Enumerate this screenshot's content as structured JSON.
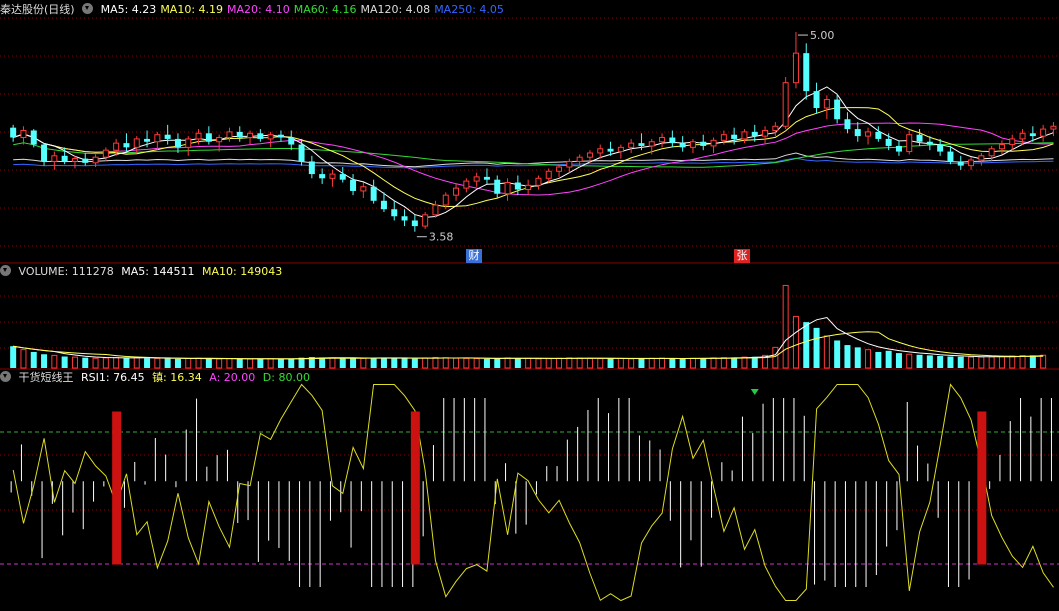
{
  "panels": {
    "price": {
      "title": "秦达股份(日线)",
      "ma": [
        {
          "label": "MA5: 4.23",
          "color": "#ffffff"
        },
        {
          "label": "MA10: 4.19",
          "color": "#ffff55"
        },
        {
          "label": "MA20: 4.10",
          "color": "#ff44ff"
        },
        {
          "label": "MA60: 4.16",
          "color": "#33dd33"
        },
        {
          "label": "MA120: 4.08",
          "color": "#dddddd"
        },
        {
          "label": "MA250: 4.05",
          "color": "#3366ff"
        }
      ],
      "high_label": "5.00",
      "low_label": "3.58",
      "events": [
        {
          "text": "财",
          "color": "#3a6fd8"
        },
        {
          "text": "张",
          "color": "#dd2222"
        }
      ]
    },
    "volume": {
      "title": "VOLUME: 111278",
      "ma5": "MA5: 144511",
      "ma10": "MA10: 149043"
    },
    "indicator": {
      "title": "干货短线王",
      "rsi": "RSI1: 76.45",
      "tan": "镇: 16.34",
      "a": "A: 20.00",
      "d": "D: 80.00"
    }
  },
  "colors": {
    "up": "#ff3a3a",
    "down": "#54ffff",
    "ma5": "#ffffff",
    "ma10": "#ffff55",
    "ma20": "#ff44ff",
    "ma60": "#33dd33",
    "ma120": "#dddddd",
    "ma250": "#3366ff",
    "vol_ma5": "#ffffff",
    "vol_ma10": "#ffff55",
    "rsi": "#ffffff",
    "line2": "#dddd22",
    "mark": "#cc1111",
    "grid": "#8b0000",
    "levelA": "#33aa33",
    "levelD": "#cc33cc"
  },
  "chart_data": {
    "type": "candlestick",
    "symbol": "秦达股份",
    "period": "日线",
    "price_high": 5.0,
    "price_low": 3.58,
    "ohlc": [
      [
        4.32,
        4.34,
        4.22,
        4.25
      ],
      [
        4.25,
        4.33,
        4.2,
        4.3
      ],
      [
        4.3,
        4.31,
        4.18,
        4.2
      ],
      [
        4.2,
        4.21,
        4.05,
        4.08
      ],
      [
        4.08,
        4.15,
        4.02,
        4.12
      ],
      [
        4.12,
        4.18,
        4.06,
        4.08
      ],
      [
        4.08,
        4.12,
        4.03,
        4.1
      ],
      [
        4.1,
        4.14,
        4.05,
        4.07
      ],
      [
        4.07,
        4.13,
        4.04,
        4.11
      ],
      [
        4.11,
        4.18,
        4.08,
        4.16
      ],
      [
        4.16,
        4.24,
        4.12,
        4.21
      ],
      [
        4.21,
        4.28,
        4.15,
        4.18
      ],
      [
        4.18,
        4.26,
        4.14,
        4.24
      ],
      [
        4.24,
        4.3,
        4.18,
        4.22
      ],
      [
        4.22,
        4.29,
        4.16,
        4.27
      ],
      [
        4.27,
        4.34,
        4.2,
        4.24
      ],
      [
        4.24,
        4.28,
        4.14,
        4.18
      ],
      [
        4.18,
        4.26,
        4.12,
        4.24
      ],
      [
        4.24,
        4.31,
        4.2,
        4.28
      ],
      [
        4.28,
        4.33,
        4.2,
        4.22
      ],
      [
        4.22,
        4.27,
        4.15,
        4.25
      ],
      [
        4.25,
        4.32,
        4.22,
        4.29
      ],
      [
        4.29,
        4.33,
        4.22,
        4.25
      ],
      [
        4.25,
        4.3,
        4.2,
        4.28
      ],
      [
        4.28,
        4.31,
        4.22,
        4.24
      ],
      [
        4.24,
        4.29,
        4.18,
        4.27
      ],
      [
        4.27,
        4.3,
        4.22,
        4.25
      ],
      [
        4.25,
        4.3,
        4.16,
        4.2
      ],
      [
        4.2,
        4.24,
        4.05,
        4.08
      ],
      [
        4.08,
        4.12,
        3.96,
        3.99
      ],
      [
        3.99,
        4.03,
        3.92,
        3.96
      ],
      [
        3.96,
        4.02,
        3.9,
        3.99
      ],
      [
        3.99,
        4.04,
        3.93,
        3.95
      ],
      [
        3.95,
        3.99,
        3.84,
        3.87
      ],
      [
        3.87,
        3.93,
        3.82,
        3.9
      ],
      [
        3.9,
        3.95,
        3.78,
        3.8
      ],
      [
        3.8,
        3.86,
        3.72,
        3.74
      ],
      [
        3.74,
        3.8,
        3.66,
        3.69
      ],
      [
        3.69,
        3.74,
        3.62,
        3.66
      ],
      [
        3.66,
        3.7,
        3.58,
        3.62
      ],
      [
        3.62,
        3.72,
        3.6,
        3.7
      ],
      [
        3.7,
        3.8,
        3.68,
        3.77
      ],
      [
        3.77,
        3.86,
        3.74,
        3.84
      ],
      [
        3.84,
        3.92,
        3.8,
        3.89
      ],
      [
        3.89,
        3.96,
        3.86,
        3.94
      ],
      [
        3.94,
        4.0,
        3.9,
        3.97
      ],
      [
        3.97,
        4.03,
        3.92,
        3.95
      ],
      [
        3.95,
        3.98,
        3.82,
        3.85
      ],
      [
        3.85,
        3.96,
        3.8,
        3.93
      ],
      [
        3.93,
        3.98,
        3.84,
        3.88
      ],
      [
        3.88,
        3.95,
        3.84,
        3.91
      ],
      [
        3.91,
        3.98,
        3.88,
        3.96
      ],
      [
        3.96,
        4.03,
        3.93,
        4.01
      ],
      [
        4.01,
        4.06,
        3.97,
        4.04
      ],
      [
        4.04,
        4.1,
        4.0,
        4.08
      ],
      [
        4.08,
        4.13,
        4.04,
        4.11
      ],
      [
        4.11,
        4.16,
        4.07,
        4.14
      ],
      [
        4.14,
        4.2,
        4.1,
        4.17
      ],
      [
        4.17,
        4.22,
        4.12,
        4.15
      ],
      [
        4.15,
        4.2,
        4.1,
        4.18
      ],
      [
        4.18,
        4.24,
        4.14,
        4.21
      ],
      [
        4.21,
        4.28,
        4.16,
        4.19
      ],
      [
        4.19,
        4.24,
        4.13,
        4.22
      ],
      [
        4.22,
        4.28,
        4.18,
        4.25
      ],
      [
        4.25,
        4.3,
        4.18,
        4.21
      ],
      [
        4.21,
        4.26,
        4.15,
        4.18
      ],
      [
        4.18,
        4.24,
        4.14,
        4.22
      ],
      [
        4.22,
        4.27,
        4.16,
        4.19
      ],
      [
        4.19,
        4.25,
        4.14,
        4.23
      ],
      [
        4.23,
        4.3,
        4.2,
        4.27
      ],
      [
        4.27,
        4.32,
        4.2,
        4.24
      ],
      [
        4.24,
        4.31,
        4.21,
        4.29
      ],
      [
        4.29,
        4.34,
        4.22,
        4.26
      ],
      [
        4.26,
        4.33,
        4.21,
        4.3
      ],
      [
        4.3,
        4.36,
        4.26,
        4.33
      ],
      [
        4.33,
        4.68,
        4.31,
        4.64
      ],
      [
        4.64,
        5.0,
        4.6,
        4.85
      ],
      [
        4.85,
        4.92,
        4.52,
        4.58
      ],
      [
        4.58,
        4.64,
        4.42,
        4.46
      ],
      [
        4.46,
        4.55,
        4.38,
        4.52
      ],
      [
        4.52,
        4.56,
        4.35,
        4.38
      ],
      [
        4.38,
        4.43,
        4.28,
        4.31
      ],
      [
        4.31,
        4.36,
        4.22,
        4.26
      ],
      [
        4.26,
        4.32,
        4.2,
        4.29
      ],
      [
        4.29,
        4.33,
        4.22,
        4.24
      ],
      [
        4.24,
        4.28,
        4.16,
        4.19
      ],
      [
        4.19,
        4.23,
        4.12,
        4.15
      ],
      [
        4.15,
        4.3,
        4.13,
        4.27
      ],
      [
        4.27,
        4.31,
        4.19,
        4.22
      ],
      [
        4.22,
        4.26,
        4.16,
        4.2
      ],
      [
        4.2,
        4.24,
        4.12,
        4.15
      ],
      [
        4.15,
        4.19,
        4.06,
        4.08
      ],
      [
        4.08,
        4.12,
        4.02,
        4.05
      ],
      [
        4.05,
        4.11,
        4.02,
        4.09
      ],
      [
        4.09,
        4.14,
        4.05,
        4.12
      ],
      [
        4.12,
        4.19,
        4.08,
        4.17
      ],
      [
        4.17,
        4.23,
        4.13,
        4.2
      ],
      [
        4.2,
        4.27,
        4.16,
        4.24
      ],
      [
        4.24,
        4.31,
        4.2,
        4.28
      ],
      [
        4.28,
        4.33,
        4.22,
        4.26
      ],
      [
        4.26,
        4.34,
        4.22,
        4.31
      ],
      [
        4.31,
        4.36,
        4.26,
        4.33
      ]
    ],
    "volume": [
      190000,
      160000,
      140000,
      120000,
      110000,
      100000,
      95000,
      90000,
      85000,
      88000,
      92000,
      87000,
      90000,
      86000,
      84000,
      82000,
      80000,
      83000,
      85000,
      81000,
      79000,
      82000,
      80000,
      78000,
      81000,
      79000,
      78000,
      82000,
      90000,
      95000,
      92000,
      88000,
      86000,
      84000,
      85000,
      88000,
      90000,
      86000,
      84000,
      82000,
      88000,
      92000,
      90000,
      86000,
      84000,
      82000,
      80000,
      84000,
      88000,
      85000,
      83000,
      80000,
      82000,
      85000,
      88000,
      86000,
      84000,
      82000,
      85000,
      83000,
      80000,
      82000,
      84000,
      86000,
      83000,
      81000,
      84000,
      86000,
      88000,
      90000,
      92000,
      95000,
      98000,
      110000,
      180000,
      720000,
      450000,
      400000,
      350000,
      280000,
      240000,
      200000,
      180000,
      160000,
      140000,
      150000,
      130000,
      120000,
      115000,
      110000,
      105000,
      100000,
      98000,
      95000,
      96000,
      98000,
      100000,
      104000,
      108000,
      110000,
      111278
    ]
  }
}
